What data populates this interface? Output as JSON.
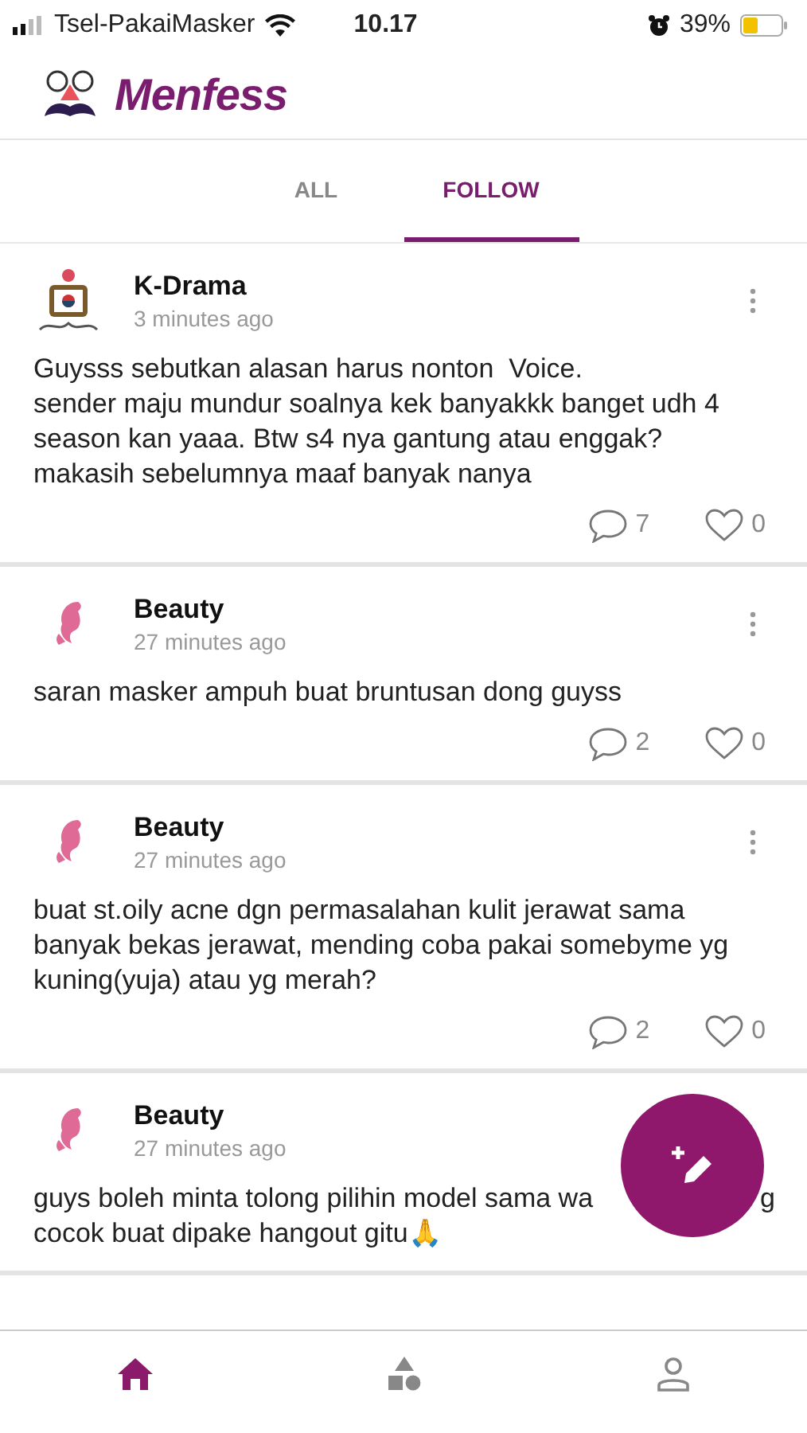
{
  "status_bar": {
    "carrier": "Tsel-PakaiMasker",
    "time": "10.17",
    "battery": "39%"
  },
  "app": {
    "title": "Menfess"
  },
  "tabs": [
    {
      "label": "ALL",
      "selected": false
    },
    {
      "label": "FOLLOW",
      "selected": true
    }
  ],
  "posts": [
    {
      "kind": "tv",
      "more": true,
      "author": "K-Drama",
      "time": "3 minutes ago",
      "lines": [
        [
          "Guysss sebutkan alasan harus nonton  Voice.\nsender maju mundur soalnya kek banyakkk banget udh 4 season kan yaaa. Btw s4 nya gantung atau enggak? makasih sebelumnya maaf banyak nanya"
        ]
      ],
      "comments": "7",
      "likes": "0"
    },
    {
      "kind": "woman",
      "more": true,
      "author": "Beauty",
      "time": "27 minutes ago",
      "lines": [
        [
          "saran masker ampuh buat bruntusan dong guyss"
        ]
      ],
      "comments": "2",
      "likes": "0"
    },
    {
      "kind": "woman",
      "more": true,
      "author": "Beauty",
      "time": "27 minutes ago",
      "lines": [
        [
          "buat st.oily acne dgn permasalahan kulit jerawat sama banyak bekas jerawat, mending coba pakai somebyme yg kuning(yuja) atau yg merah?"
        ]
      ],
      "comments": "2",
      "likes": "0"
    },
    {
      "kind": "woman",
      "more": false,
      "author": "Beauty",
      "time": "27 minutes ago",
      "lines": [
        [
          "guys boleh minta tolong pilihin model sama wa",
          "g"
        ],
        [
          "cocok buat dipake hangout gitu🙏"
        ]
      ]
    }
  ],
  "bottom_nav": [
    {
      "kind": "home",
      "selected": true
    },
    {
      "kind": "shapes",
      "selected": false
    },
    {
      "kind": "person",
      "selected": false
    }
  ]
}
